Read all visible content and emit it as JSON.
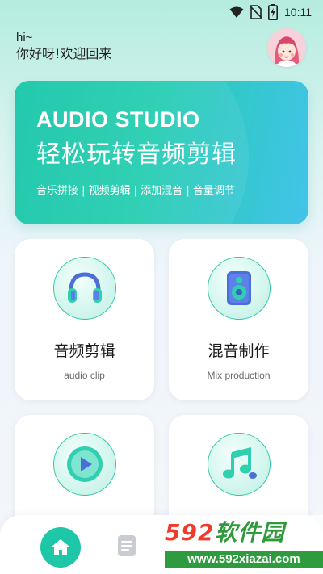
{
  "status_bar": {
    "time": "10:11",
    "icons": [
      "wifi-icon",
      "no-sim-icon",
      "battery-charging-icon"
    ]
  },
  "greeting": {
    "hi": "hi~",
    "welcome": "你好呀!欢迎回来"
  },
  "avatar": {
    "icon": "girl-avatar",
    "colors": {
      "bg": "#f7d2da",
      "hair": "#e45b78"
    }
  },
  "banner": {
    "eyebrow": "AUDIO STUDIO",
    "title": "轻松玩转音频剪辑",
    "tags": "音乐拼接 | 视频剪辑 | 添加混音 | 音量调节",
    "colors": {
      "start": "#13c5a6",
      "end": "#43c3e9"
    }
  },
  "features": [
    {
      "title": "音频剪辑",
      "subtitle": "audio clip",
      "icon": "headphones-icon"
    },
    {
      "title": "混音制作",
      "subtitle": "Mix production",
      "icon": "speaker-icon"
    },
    {
      "title": "",
      "subtitle": "",
      "icon": "play-button-icon"
    },
    {
      "title": "",
      "subtitle": "",
      "icon": "music-note-icon"
    }
  ],
  "bottom_nav": {
    "items": [
      {
        "icon": "home-icon",
        "active": true
      },
      {
        "icon": "document-icon",
        "active": false
      }
    ],
    "accent": "#1ec7a8"
  },
  "watermark": {
    "logo_number": "592",
    "logo_text": "软件园",
    "url": "www.592xiazai.com"
  }
}
